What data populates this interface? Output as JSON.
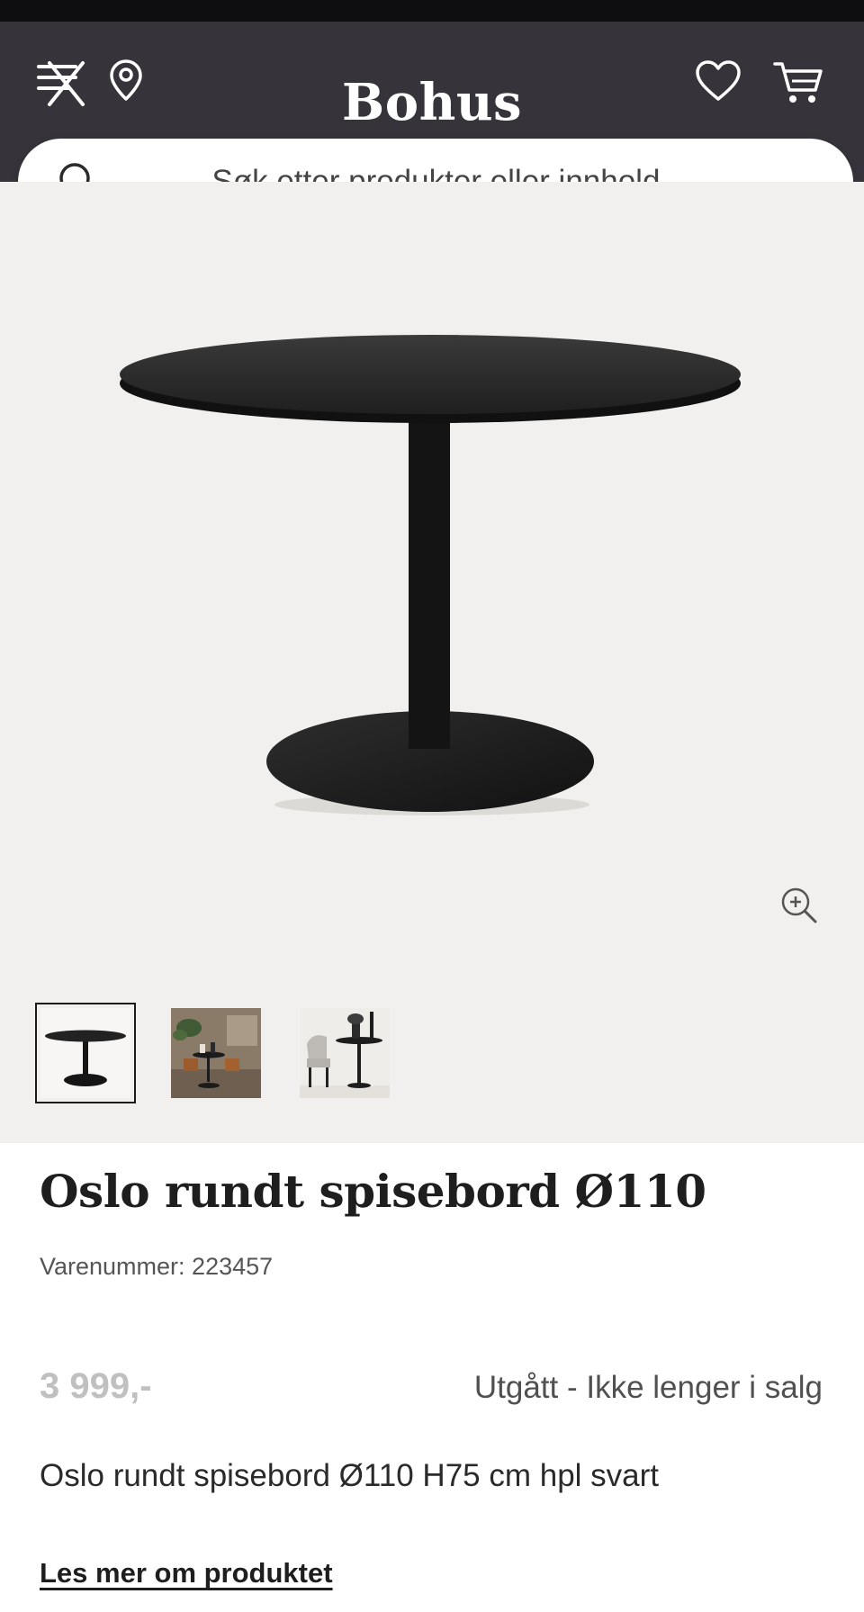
{
  "header": {
    "logo": "Bohus",
    "background": "#36343a",
    "icons": [
      "menu-close-icon",
      "location-pin-icon",
      "heart-icon",
      "cart-icon"
    ]
  },
  "search": {
    "placeholder": "Søk etter produkter eller innhold...",
    "icon": "search-icon"
  },
  "gallery": {
    "background": "#f2f0ee",
    "main_image": "black-round-pedestal-table",
    "zoom_icon": "zoom-in-icon",
    "thumbnails": [
      {
        "name": "table-product-shot",
        "active": true
      },
      {
        "name": "dining-room-scene",
        "active": false
      },
      {
        "name": "table-with-chair-scene",
        "active": false
      }
    ]
  },
  "product": {
    "title": "Oslo rundt spisebord Ø110",
    "sku": "Varenummer: 223457",
    "price": "3 999,-",
    "availability": "Utgått - Ikke lenger i salg",
    "description": "Oslo rundt spisebord Ø110 H75 cm hpl svart",
    "read_more": "Les mer om produktet"
  }
}
